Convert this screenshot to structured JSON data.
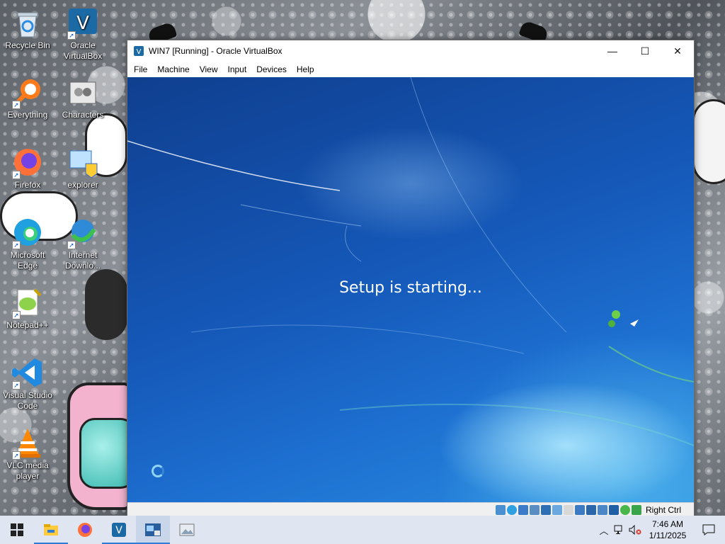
{
  "desktop": {
    "icons": [
      {
        "label": "Recycle Bin",
        "icon": "recycle-bin-icon"
      },
      {
        "label": "Oracle VirtualBox",
        "icon": "virtualbox-icon"
      },
      {
        "label": "Everything",
        "icon": "everything-search-icon"
      },
      {
        "label": "Characters",
        "icon": "characters-icon"
      },
      {
        "label": "Firefox",
        "icon": "firefox-icon"
      },
      {
        "label": "explorer",
        "icon": "explorer-icon"
      },
      {
        "label": "Microsoft Edge",
        "icon": "edge-icon"
      },
      {
        "label": "Internet Downlo...",
        "icon": "internet-download-manager-icon"
      },
      {
        "label": "Notepad++",
        "icon": "notepad-plus-plus-icon"
      },
      {
        "label": "Visual Studio Code",
        "icon": "vscode-icon"
      },
      {
        "label": "VLC media player",
        "icon": "vlc-icon"
      }
    ]
  },
  "window": {
    "title": "WIN7 [Running] - Oracle VirtualBox",
    "menu": [
      "File",
      "Machine",
      "View",
      "Input",
      "Devices",
      "Help"
    ],
    "minimize_glyph": "—",
    "maximize_glyph": "☐",
    "close_glyph": "✕"
  },
  "vm": {
    "setup_text": "Setup is starting...",
    "host_key": "Right Ctrl"
  },
  "taskbar": {
    "items": [
      "start-icon",
      "file-explorer-icon",
      "firefox-icon",
      "virtualbox-icon",
      "virtualbox-manager-icon",
      "photos-icon"
    ],
    "time": "7:46 AM",
    "date": "1/11/2025"
  },
  "colors": {
    "vm_blue": "#1558b8",
    "taskbar_bg": "#dfe6f1",
    "accent": "#2f7bd6"
  }
}
